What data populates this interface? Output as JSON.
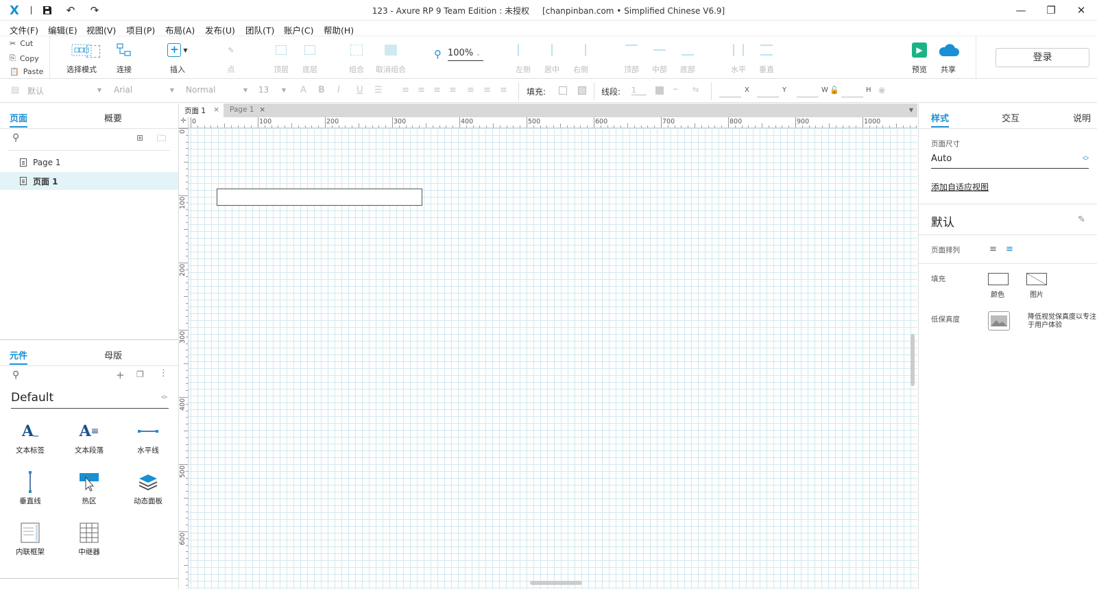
{
  "titlebar": {
    "title": "123 - Axure RP 9 Team Edition : 未授权     [chanpinban.com • Simplified Chinese V6.9]",
    "icons": [
      "axure-logo-icon",
      "save-icon",
      "undo-icon",
      "redo-icon"
    ],
    "window_controls": [
      "minimize-icon",
      "restore-icon",
      "close-icon"
    ]
  },
  "menubar": {
    "items": [
      "文件(F)",
      "编辑(E)",
      "视图(V)",
      "项目(P)",
      "布局(A)",
      "发布(U)",
      "团队(T)",
      "账户(C)",
      "帮助(H)"
    ]
  },
  "ribbon": {
    "clipboard": [
      "Cut",
      "Copy",
      "Paste"
    ],
    "tools": {
      "select_mode": "选择模式",
      "connect": "连接",
      "insert": "插入",
      "point": "点",
      "top_layer": "顶层",
      "bottom_layer": "底层",
      "group": "组合",
      "ungroup": "取消组合",
      "zoom": "100%",
      "align_left": "左侧",
      "align_center": "居中",
      "align_right": "右侧",
      "align_top": "顶部",
      "align_middle": "中部",
      "align_bottom": "底部",
      "dist_h": "水平",
      "dist_v": "垂直",
      "preview": "预览",
      "share": "共享",
      "login": "登录"
    },
    "accent_color": "#4aa8d8",
    "preview_color": "#1bb386"
  },
  "formatbar": {
    "style": "默认",
    "font": "Arial",
    "weight": "Normal",
    "size": "13",
    "fill_label": "填充:",
    "line_label": "线段:",
    "line_value": "1",
    "coords": [
      "X",
      "Y",
      "W",
      "H"
    ]
  },
  "leftpanel": {
    "tabs": [
      "页面",
      "概要"
    ],
    "pages": [
      "Page 1",
      "页面 1"
    ],
    "lib_tabs": [
      "元件",
      "母版"
    ],
    "library": "Default",
    "widgets": [
      "文本标签",
      "文本段落",
      "水平线",
      "垂直线",
      "热区",
      "动态面板",
      "内联框架",
      "中继器"
    ]
  },
  "canvas": {
    "tabs": [
      "页面 1",
      "Page 1"
    ],
    "ruler_h": [
      "0",
      "100",
      "200",
      "300",
      "400",
      "500",
      "600",
      "700",
      "800",
      "900",
      "1000"
    ],
    "ruler_v": [
      "0",
      "100",
      "200",
      "300",
      "400",
      "500",
      "600"
    ]
  },
  "rightpanel": {
    "tabs": [
      "样式",
      "交互",
      "说明"
    ],
    "page_size_label": "页面尺寸",
    "page_size_value": "Auto",
    "add_adaptive": "添加自适应视图",
    "style_name": "默认",
    "page_align_label": "页面排列",
    "fill_label": "填充",
    "fill_color": "颜色",
    "fill_image": "图片",
    "low_fidelity_label": "低保真度",
    "low_fidelity_desc": "降低视觉保真度以专注于用户体验"
  }
}
